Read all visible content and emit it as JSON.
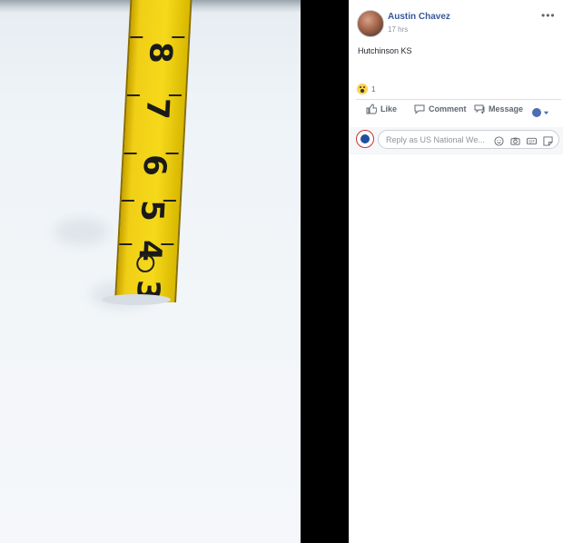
{
  "post": {
    "author": "Austin Chavez",
    "time": "17 hrs",
    "text": "Hutchinson KS",
    "more_label": "•••",
    "reaction_count": "1",
    "reaction_type": "wow-reaction"
  },
  "actions": {
    "like": "Like",
    "comment": "Comment",
    "message": "Message"
  },
  "reply": {
    "placeholder": "Reply as US National We..."
  },
  "photo": {
    "tape_numbers": [
      "8",
      "7",
      "6",
      "5",
      "4",
      "3"
    ]
  },
  "colors": {
    "link": "#365899",
    "tape": "#f0cf16"
  }
}
